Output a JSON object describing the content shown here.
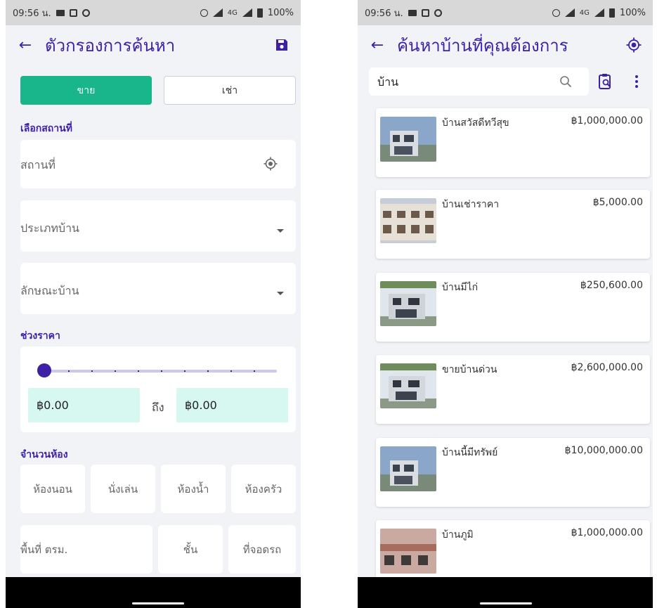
{
  "left_screen": {
    "status": {
      "time": "09:56 น.",
      "network": "4G",
      "battery": "100%"
    },
    "appbar": {
      "title": "ตัวกรองการค้นหา"
    },
    "segment": {
      "sell_label": "ขาย",
      "rent_label": "เช่า",
      "selected": "sell"
    },
    "location_section": {
      "title": "เลือกสถานที่",
      "location_placeholder": "สถานที่",
      "house_type_placeholder": "ประเภทบ้าน",
      "house_style_placeholder": "ลักษณะบ้าน"
    },
    "price_section": {
      "title": "ช่วงราคา",
      "min_value": "฿0.00",
      "to_label": "ถึง",
      "max_value": "฿0.00",
      "slider_value": 0
    },
    "rooms_section": {
      "title": "จำนวนห้อง",
      "bedroom": "ห้องนอน",
      "living_room": "นั่งเล่น",
      "bathroom": "ห้องน้ำ",
      "kitchen": "ห้องครัว",
      "area": "พื้นที่ ตรม.",
      "floors": "ชั้น",
      "parking": "ที่จอดรถ"
    }
  },
  "right_screen": {
    "status": {
      "time": "09:56 น.",
      "network": "4G",
      "battery": "100%"
    },
    "appbar": {
      "title": "ค้นหาบ้านที่คุณต้องการ"
    },
    "search": {
      "value": "บ้าน"
    },
    "listings": [
      {
        "name": "บ้านสวัสดีทวีสุข",
        "price": "฿1,000,000.00"
      },
      {
        "name": "บ้านเช่าราคา",
        "price": "฿5,000.00"
      },
      {
        "name": "บ้านมีไก่",
        "price": "฿250,600.00"
      },
      {
        "name": "ขายบ้านด่วน",
        "price": "฿2,600,000.00"
      },
      {
        "name": "บ้านนี้มีทรัพย์",
        "price": "฿10,000,000.00"
      },
      {
        "name": "บ้านภูมิ",
        "price": "฿1,000,000.00"
      }
    ]
  },
  "colors": {
    "primary": "#3d1fa8",
    "accent": "#19b58b",
    "price_field": "#d7f8f0",
    "background": "#f2f3f7"
  },
  "icons": [
    "back-arrow-icon",
    "save-icon",
    "location-target-icon",
    "dropdown-caret-icon",
    "search-icon",
    "clipboard-search-icon",
    "more-vert-icon"
  ]
}
